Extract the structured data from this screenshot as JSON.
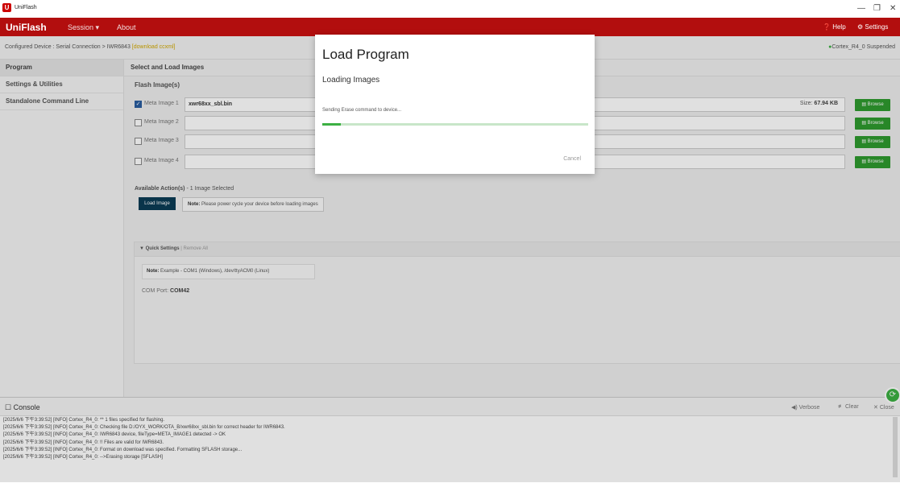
{
  "window": {
    "title": "UniFlash",
    "minimize": "—",
    "maximize": "❐",
    "close": "✕"
  },
  "menubar": {
    "brand": "UniFlash",
    "session": "Session ▾",
    "about": "About",
    "help": "Help",
    "settings": "Settings",
    "color": "#b20e0e"
  },
  "device": {
    "configured": "Configured Device : Serial Connection  >  IWR6843",
    "download_link": "[download ccxml]",
    "core_status": "Cortex_R4_0 Suspended"
  },
  "nav": {
    "items": [
      {
        "label": "Program"
      },
      {
        "label": "Settings & Utilities"
      },
      {
        "label": "Standalone Command Line"
      }
    ]
  },
  "main": {
    "section_title": "Select and Load Images",
    "flash_label": "Flash Image(s)",
    "images": [
      {
        "label": "Meta Image 1",
        "checked": true,
        "file": "xwr68xx_sbl.bin",
        "size_label": "Size:",
        "size_value": "67.94 KB"
      },
      {
        "label": "Meta Image 2",
        "checked": false,
        "file": ""
      },
      {
        "label": "Meta Image 3",
        "checked": false,
        "file": ""
      },
      {
        "label": "Meta Image 4",
        "checked": false,
        "file": ""
      }
    ],
    "browse_label": "Browse",
    "actions_title": "Available Action(s)",
    "actions_count": " - 1 Image Selected",
    "load_button": "Load Image",
    "note_prefix": "Note:",
    "note_text": " Please power cycle your device before loading images"
  },
  "quick_settings": {
    "header": "Quick Settings",
    "remove_all": " | Remove All",
    "note_prefix": "Note:",
    "note_text": " Example - COM1 (Windows), /dev/ttyACM0 (Linux)",
    "port_label": "COM Port:",
    "port_value": "COM42"
  },
  "console": {
    "title": "Console",
    "verbose": "Verbose",
    "clear": "Clear",
    "close": "Close",
    "lines": [
      "[2025/6/6 下午3:39:52] [INFO] Cortex_R4_0: ** 1 files specified for flashing.",
      "[2025/6/6 下午3:39:52] [INFO] Cortex_R4_0: Checking file D:/OYX_WORK/OTA_B/xwr68xx_sbl.bin for correct header for IWR6843.",
      "[2025/6/6 下午3:39:52] [INFO] Cortex_R4_0: IWR6843 device, fileType=META_IMAGE1 detected -> OK",
      "[2025/6/6 下午3:39:52] [INFO] Cortex_R4_0: !! Files are valid for IWR6843.",
      "[2025/6/6 下午3:39:52] [INFO] Cortex_R4_0: Format on download was specified. Formatting SFLASH storage...",
      "[2025/6/6 下午3:39:52] [INFO] Cortex_R4_0: -->Erasing storage [SFLASH]"
    ]
  },
  "dialog": {
    "title": "Load Program",
    "subtitle": "Loading Images",
    "status": "Sending Erase command to device...",
    "progress": 0.07,
    "cancel": "Cancel"
  }
}
